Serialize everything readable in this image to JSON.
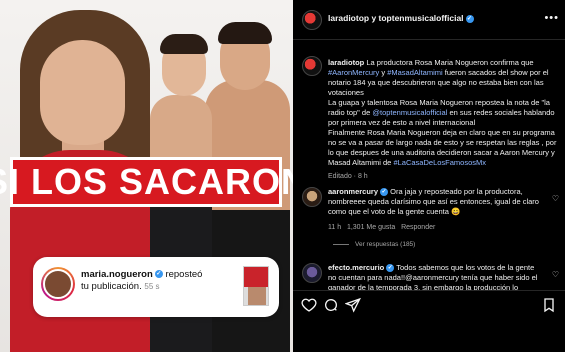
{
  "image": {
    "headline": "SI LOS SACARON",
    "story": {
      "username": "maria.nogueron",
      "action": "reposteó tu publicación.",
      "time": "55 s"
    }
  },
  "post": {
    "header": {
      "title": "laradiotop y toptenmusicalofficial",
      "more_icon": "more-horizontal-icon"
    },
    "caption": {
      "username": "laradiotop",
      "text_1": "La productora Rosa Maria Nogueron confirma que",
      "tag_1": "#AaronMercury",
      "text_2": "y",
      "tag_2": "#MasadAltamimi",
      "text_3": "fueron sacados del show por el notario 184 ya que descubrieron que algo no estaba bien con las votaciones",
      "text_4": "La guapa y talentosa Rosa Maria Nogueron repostea la nota de \"la radio top\" de",
      "mention_1": "@toptenmusicalofficial",
      "text_5": "en sus redes sociales hablando por primera vez de esto a nivel internacional",
      "text_6": "Finalmente Rosa Maria Nogueron deja en claro que en su programa no se va a pasar de largo nada de esto y se respetan las reglas , por lo que despues de una auditoria decidieron sacar a Aaron Mercury y Masad Altamimi de",
      "tag_3": "#LaCasaDeLosFamososMx",
      "meta": "Editado · 8 h"
    },
    "comments": [
      {
        "username": "aaronmercury",
        "text": "Ora jaja y reposteado por la productora, nombreeee queda clarísimo que así es entonces, igual de claro como que el voto de la gente cuenta 😀",
        "time": "11 h",
        "likes": "1,301 Me gusta",
        "reply": "Responder"
      },
      {
        "username": "efecto.mercurio",
        "text": "Todos sabemos que los votos de la gente no cuentan para nada!!@aaronmercury tenía que haber sido el ganador de la temporada 3, sin embargo la producción lo"
      }
    ],
    "view_replies": "Ver respuestas (185)"
  },
  "colors": {
    "headline_red": "#d71920",
    "link_blue": "#8fb6ff",
    "verified_blue": "#3897f0"
  }
}
